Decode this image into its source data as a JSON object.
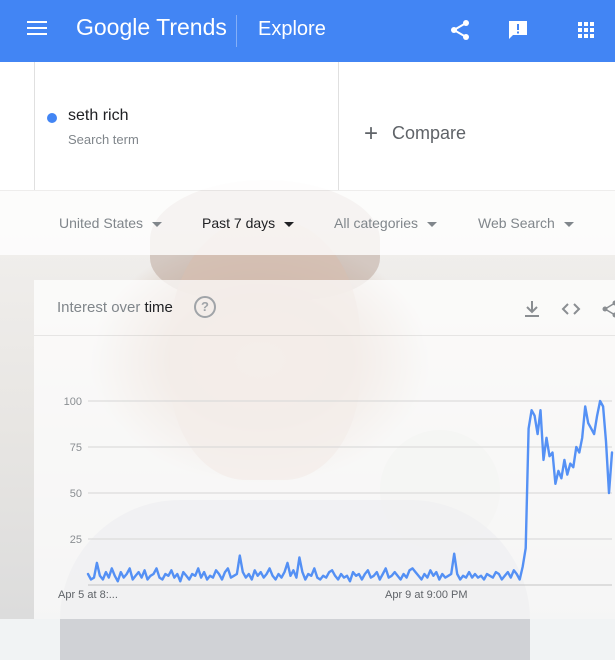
{
  "header": {
    "brand_word1": "Google",
    "brand_word2": "Trends",
    "section_title": "Explore",
    "background_color": "#4285f4",
    "icons": [
      "menu-icon",
      "share-icon",
      "feedback-icon",
      "apps-grid-icon"
    ]
  },
  "search": {
    "term": "seth rich",
    "term_type": "Search term",
    "term_color": "#4285f4",
    "compare_label": "Compare"
  },
  "filters": {
    "region": "United States",
    "time_range": "Past 7 days",
    "category": "All categories",
    "search_type": "Web Search"
  },
  "chart_card": {
    "title_part1": "Interest over ",
    "title_part2": "time",
    "help_symbol": "?",
    "icons": [
      "download-icon",
      "embed-code-icon",
      "share-icon"
    ]
  },
  "chart_data": {
    "type": "line",
    "title": "",
    "xlabel": "",
    "ylabel": "",
    "ylim": [
      0,
      100
    ],
    "y_ticks": [
      25,
      50,
      75,
      100
    ],
    "x_tick_labels": [
      "Apr 5 at 8:...",
      "Apr 9 at 9:00 PM"
    ],
    "grid": true,
    "series_color": "#4285f4",
    "series": [
      {
        "values": [
          6,
          3,
          4,
          12,
          5,
          3,
          7,
          4,
          9,
          5,
          2,
          7,
          4,
          6,
          9,
          3,
          5,
          7,
          4,
          8,
          3,
          5,
          6,
          9,
          4,
          3,
          6,
          5,
          8,
          4,
          6,
          2,
          7,
          5,
          3,
          6,
          5,
          9,
          4,
          7,
          3,
          5,
          4,
          8,
          6,
          3,
          7,
          9,
          4,
          5,
          6,
          16,
          7,
          4,
          6,
          3,
          8,
          5,
          7,
          4,
          6,
          9,
          5,
          3,
          6,
          4,
          7,
          12,
          5,
          8,
          4,
          15,
          7,
          3,
          6,
          5,
          9,
          4,
          3,
          5,
          4,
          7,
          8,
          5,
          3,
          6,
          4,
          5,
          2,
          7,
          5,
          6,
          3,
          6,
          8,
          4,
          5,
          7,
          3,
          6,
          9,
          4,
          5,
          7,
          5,
          3,
          6,
          4,
          8,
          9,
          7,
          5,
          3,
          6,
          4,
          8,
          5,
          7,
          3,
          6,
          4,
          5,
          6,
          17,
          6,
          3,
          5,
          4,
          7,
          4,
          6,
          4,
          5,
          3,
          6,
          5,
          4,
          7,
          6,
          3,
          5,
          7,
          4,
          8,
          6,
          3,
          10,
          20,
          85,
          95,
          92,
          82,
          95,
          68,
          80,
          70,
          72,
          55,
          62,
          58,
          68,
          60,
          66,
          64,
          75,
          72,
          80,
          97,
          88,
          85,
          82,
          92,
          100,
          97,
          78,
          50,
          72
        ]
      }
    ]
  }
}
